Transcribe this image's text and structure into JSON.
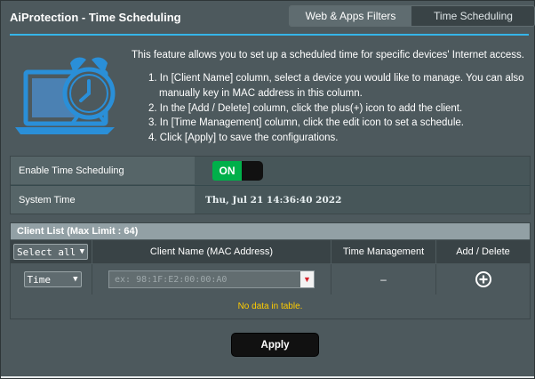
{
  "header": {
    "title": "AiProtection - Time Scheduling",
    "tabs": [
      {
        "label": "Web & Apps Filters"
      },
      {
        "label": "Time Scheduling"
      }
    ]
  },
  "intro": "This feature allows you to set up a scheduled time for specific devices' Internet access.",
  "steps": [
    "1. In [Client Name] column, select a device you would like to manage. You can also",
    "manually key in MAC address in this column.",
    "2. In the [Add / Delete] column, click the plus(+) icon to add the client.",
    "3. In [Time Management] column, click the edit icon to set a schedule.",
    "4. Click [Apply] to save the configurations."
  ],
  "settings": {
    "enable_label": "Enable Time Scheduling",
    "toggle_label": "ON",
    "system_time_label": "System Time",
    "system_time_value": "Thu, Jul 21 14:36:40 2022"
  },
  "client_list": {
    "title": "Client List (Max Limit : 64)",
    "columns": {
      "select": "Select all",
      "client": "Client Name (MAC Address)",
      "time": "Time Management",
      "add_delete": "Add / Delete"
    },
    "row": {
      "time_select": "Time",
      "mac_placeholder": "ex: 98:1F:E2:00:00:A0",
      "time_value": "–"
    },
    "empty_message": "No data in table."
  },
  "apply_label": "Apply",
  "colors": {
    "accent": "#35b5e9",
    "toggle_on": "#00b04a",
    "warning_text": "#ffcc00"
  }
}
